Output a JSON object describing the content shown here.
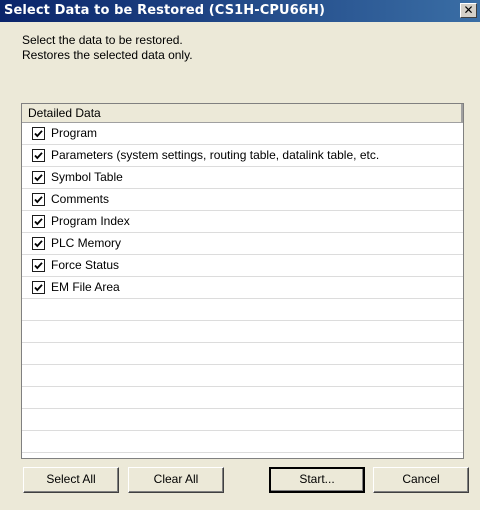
{
  "window": {
    "title": "Select Data to be Restored (CS1H-CPU66H)",
    "close_label": "✕"
  },
  "description": {
    "line1": "Select the data to be restored.",
    "line2": "Restores the selected data only."
  },
  "list": {
    "header": "Detailed Data",
    "items": [
      {
        "label": "Program",
        "checked": true
      },
      {
        "label": "Parameters (system settings, routing table, datalink table, etc.",
        "checked": true
      },
      {
        "label": "Symbol Table",
        "checked": true
      },
      {
        "label": "Comments",
        "checked": true
      },
      {
        "label": "Program Index",
        "checked": true
      },
      {
        "label": "PLC Memory",
        "checked": true
      },
      {
        "label": "Force Status",
        "checked": true
      },
      {
        "label": "EM File Area",
        "checked": true
      }
    ]
  },
  "buttons": {
    "select_all": "Select All",
    "clear_all": "Clear All",
    "start": "Start...",
    "cancel": "Cancel"
  },
  "colors": {
    "title_bar": "#0a246a",
    "dialog_bg": "#ece9d8"
  }
}
